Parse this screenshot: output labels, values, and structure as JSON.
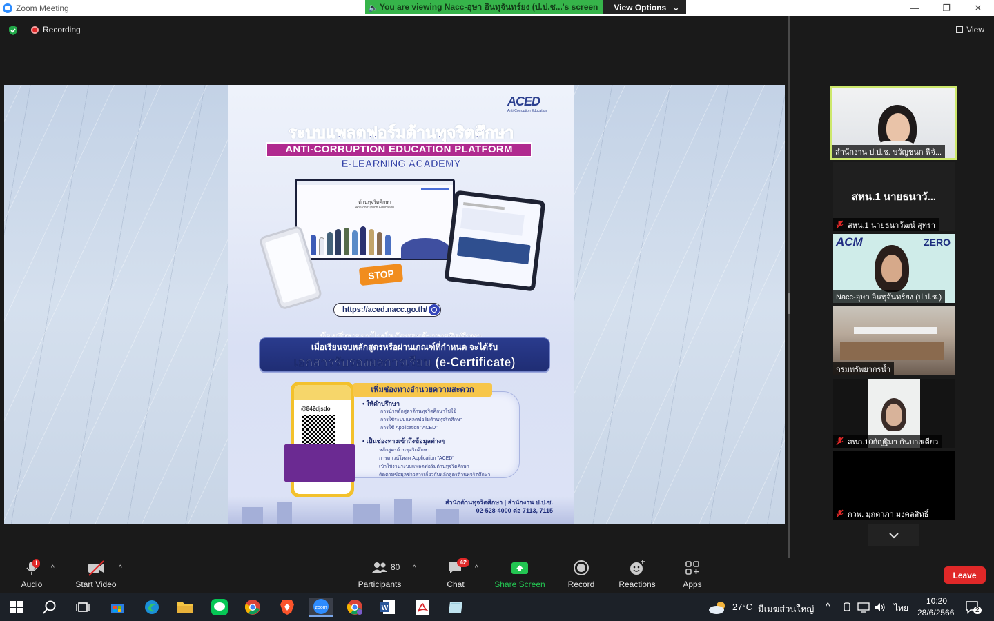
{
  "window": {
    "title": "Zoom Meeting",
    "controls": {
      "minimize": "—",
      "restore": "❐",
      "close": "✕"
    }
  },
  "share_banner": {
    "message": "You are viewing Nacc-อุษา อินทุจันทร์ยง (ป.ป.ช...'s screen",
    "view_options": "View Options"
  },
  "topbar": {
    "recording_label": "Recording",
    "view_label": "View"
  },
  "poster": {
    "logo_text": "ACED",
    "logo_sub": "Anti-Corruption Education",
    "thai_title": "ระบบแพลตฟอร์มต้านทุจริตศึกษา",
    "english_title": "ANTI-CORRUPTION EDUCATION PLATFORM",
    "elearning": "E-LEARNING ACADEMY",
    "laptop_text1": "ต้านทุจริตศึกษา",
    "laptop_text2": "Anti-corruption Education",
    "stop_text": "STOP",
    "url": "https://aced.nacc.go.th/",
    "course_line1": "ห้องเรียนออนไลน์หลักสูตรต้านทุจริตศึกษา",
    "course_line2": "เมื่อเรียนจบหลักสูตรหรือผ่านเกณฑ์ที่กำหนด จะได้รับ",
    "certificate": "เอกสารรับรองผลการเรียน (e-Certificate)",
    "convenience_header": "เพิ่มช่องทางอำนวยความสะดวก",
    "line_id": "@842djsdo",
    "bullet1": "• ให้คำปรึกษา",
    "bullet1_items": [
      "การนำหลักสูตรต้านทุจริตศึกษาไปใช้",
      "การใช้ระบบแพลตฟอร์มต้านทุจริตศึกษา",
      "การใช้ Application \"ACED\""
    ],
    "bullet2": "• เป็นช่องทางเข้าถึงข้อมูลต่างๆ",
    "bullet2_items": [
      "หลักสูตรต้านทุจริตศึกษา",
      "การดาวน์โหลด Application \"ACED\"",
      "เข้าใช้งานระบบแพลตฟอร์มต้านทุจริตศึกษา",
      "ติดตามข้อมูลข่าวสารเกี่ยวกับหลักสูตรต้านทุจริตศึกษา"
    ],
    "footer1": "สำนักต้านทุจริตศึกษา | สำนักงาน ป.ป.ช.",
    "footer2": "02-528-4000 ต่อ 7113, 7115"
  },
  "participants_gallery": [
    {
      "name": "สำนักงาน ป.ป.ช. ขวัญชนก ฟีจั...",
      "muted": false,
      "active": true
    },
    {
      "name": "สหน.1 นายธนาวัฒน์ สุทรา",
      "display_name": "สหน.1 นายธนาวั...",
      "muted": true,
      "video": false
    },
    {
      "name": "Nacc-อุษา อินทุจันทร์ยง (ป.ป.ช.)",
      "muted": false,
      "logo_left": "ACM",
      "logo_right": "ZERO"
    },
    {
      "name": "กรมทรัพยากรน้ำ",
      "muted": false
    },
    {
      "name": "สทภ.10กัญฐิมา กันบางเตียว",
      "muted": true
    },
    {
      "name": "กวพ. มุกตาภา มงคลสิทธิ์",
      "muted": true,
      "video": false
    }
  ],
  "toolbar": {
    "audio": "Audio",
    "start_video": "Start Video",
    "participants": "Participants",
    "participants_count": "80",
    "chat": "Chat",
    "chat_badge": "42",
    "audio_badge": "!",
    "share_screen": "Share Screen",
    "record": "Record",
    "reactions": "Reactions",
    "apps": "Apps",
    "leave": "Leave"
  },
  "taskbar": {
    "weather": "27°C",
    "location": "มีเมฆส่วนใหญ่",
    "language": "ไทย",
    "time": "10:20",
    "date": "28/6/2566",
    "notifications": "2"
  },
  "colors": {
    "share_green": "#36b44a",
    "leave_red": "#e02828",
    "active_speaker": "#cde86b",
    "share_screen_icon": "#23c552"
  }
}
